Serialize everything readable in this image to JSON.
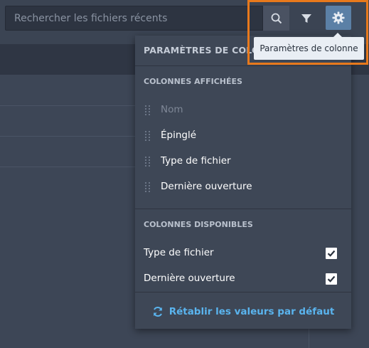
{
  "search": {
    "placeholder": "Rechercher les fichiers récents",
    "search_icon": "search-icon",
    "filter_icon": "filter-icon",
    "settings_icon": "gear-icon"
  },
  "tooltip": {
    "text": "Paramètres de colonne"
  },
  "panel": {
    "title": "PARAMÈTRES DE COLONNE",
    "displayed_section": "COLONNES AFFICHÉES",
    "displayed_columns": [
      {
        "label": "Nom",
        "enabled": false
      },
      {
        "label": "Épinglé",
        "enabled": true
      },
      {
        "label": "Type de fichier",
        "enabled": true
      },
      {
        "label": "Dernière ouverture",
        "enabled": true
      }
    ],
    "available_section": "COLONNES DISPONIBLES",
    "available_columns": [
      {
        "label": "Type de fichier",
        "checked": true
      },
      {
        "label": "Dernière ouverture",
        "checked": true
      }
    ],
    "reset_label": "Rétablir les valeurs par défaut"
  },
  "colors": {
    "background": "#3b4453",
    "accent": "#5b80a6",
    "link": "#5ab4ee",
    "highlight": "#e8791c"
  }
}
